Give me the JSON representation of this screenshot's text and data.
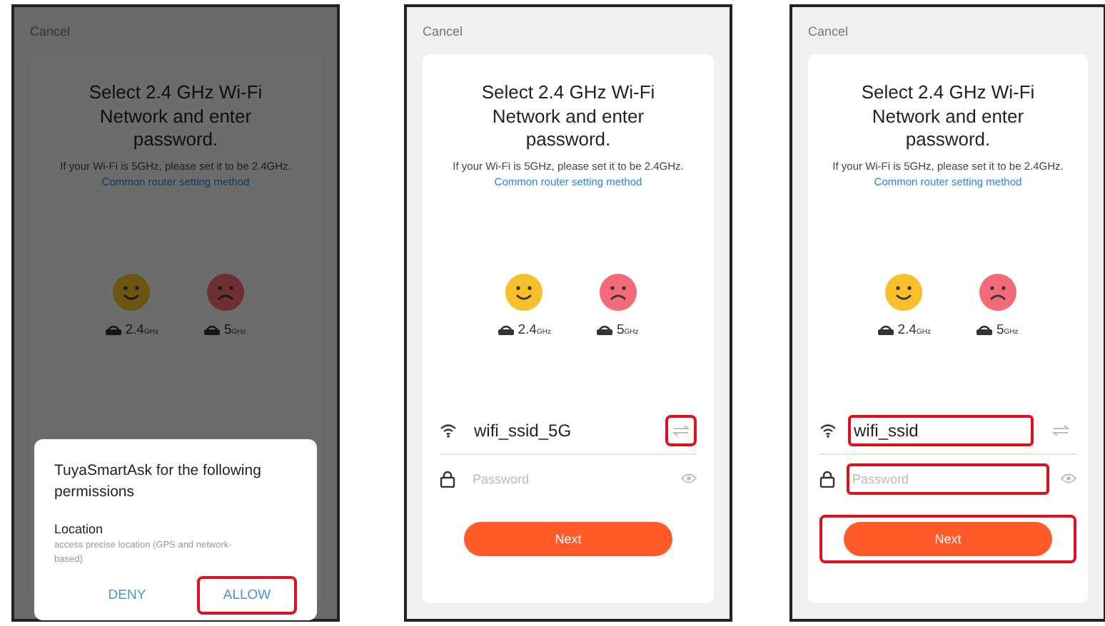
{
  "screens": [
    {
      "dimmed": true,
      "cancel": "Cancel",
      "title": "Select 2.4 GHz Wi-Fi Network and enter password.",
      "hint": "If your Wi-Fi is 5GHz, please set it to be 2.4GHz.",
      "link": "Common router setting method",
      "bands": [
        {
          "kind": "good",
          "value": "2.4",
          "unit": "GHz"
        },
        {
          "kind": "bad",
          "value": "5",
          "unit": "GHz"
        }
      ],
      "dialog": {
        "title": "TuyaSmartAsk for the following permissions",
        "permission": "Location",
        "description": "access precise location (GPS and network-based)",
        "buttons": [
          {
            "label": "DENY",
            "highlighted": false
          },
          {
            "label": "ALLOW",
            "highlighted": true
          }
        ]
      }
    },
    {
      "dimmed": false,
      "cancel": "Cancel",
      "title": "Select 2.4 GHz Wi-Fi Network and enter password.",
      "hint": "If your Wi-Fi is 5GHz, please set it to be 2.4GHz.",
      "link": "Common router setting method",
      "bands": [
        {
          "kind": "good",
          "value": "2.4",
          "unit": "GHz"
        },
        {
          "kind": "bad",
          "value": "5",
          "unit": "GHz"
        }
      ],
      "form": {
        "ssid": {
          "value": "wifi_ssid_5G",
          "highlighted": false
        },
        "switch_highlighted": true,
        "password": {
          "placeholder": "Password",
          "highlighted": false
        },
        "next": {
          "label": "Next",
          "highlighted": false
        }
      }
    },
    {
      "dimmed": false,
      "cancel": "Cancel",
      "title": "Select 2.4 GHz Wi-Fi Network and enter password.",
      "hint": "If your Wi-Fi is 5GHz, please set it to be 2.4GHz.",
      "link": "Common router setting method",
      "bands": [
        {
          "kind": "good",
          "value": "2.4",
          "unit": "GHz"
        },
        {
          "kind": "bad",
          "value": "5",
          "unit": "GHz"
        }
      ],
      "form": {
        "ssid": {
          "value": "wifi_ssid",
          "highlighted": true
        },
        "switch_highlighted": false,
        "password": {
          "placeholder": "Password",
          "highlighted": true
        },
        "next": {
          "label": "Next",
          "highlighted": true
        }
      }
    }
  ]
}
